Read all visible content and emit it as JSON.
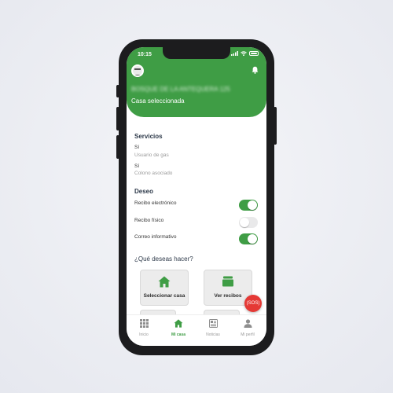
{
  "status_bar": {
    "time": "10:15"
  },
  "header": {
    "house_name": "BOSQUE DE LA ANTEQUERA 125",
    "house_caption": "Casa seleccionada",
    "accent_color": "#3f9d45"
  },
  "services": {
    "title": "Servicios",
    "items": [
      {
        "value": "Sí",
        "label": "Usuario de gas"
      },
      {
        "value": "Sí",
        "label": "Colono asociado"
      }
    ]
  },
  "preferences": {
    "title": "Deseo",
    "items": [
      {
        "label": "Recibo electrónico",
        "enabled": true
      },
      {
        "label": "Recibo físico",
        "enabled": false
      },
      {
        "label": "Correo informativo",
        "enabled": true
      }
    ]
  },
  "actions": {
    "question": "¿Qué deseas hacer?",
    "items": [
      {
        "label": "Seleccionar casa",
        "icon": "house-icon"
      },
      {
        "label": "Ver recibos",
        "icon": "inbox-icon"
      }
    ]
  },
  "sos": {
    "label": "(SOS)",
    "color": "#e53935"
  },
  "tabbar": {
    "items": [
      {
        "label": "Inicio",
        "icon": "grid-icon",
        "active": false
      },
      {
        "label": "Mi casa",
        "icon": "house-icon",
        "active": true
      },
      {
        "label": "Noticias",
        "icon": "newspaper-icon",
        "active": false
      },
      {
        "label": "Mi perfil",
        "icon": "person-icon",
        "active": false
      }
    ]
  }
}
